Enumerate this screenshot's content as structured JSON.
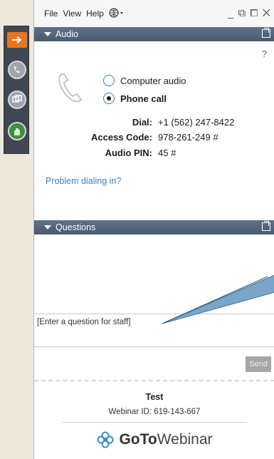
{
  "menubar": {
    "file": "File",
    "view": "View",
    "help": "Help",
    "globe_icon": "globe-icon",
    "window_controls": "_ ⧉ ⧠ ✕"
  },
  "audio": {
    "header": "Audio",
    "help_mark": "?",
    "option_computer": "Computer audio",
    "option_phone": "Phone call",
    "dial_label": "Dial:",
    "dial_value": "+1 (562) 247-8422",
    "access_label": "Access Code:",
    "access_value": "978-261-249 #",
    "pin_label": "Audio PIN:",
    "pin_value": "45 #",
    "problem_link": "Problem dialing in?"
  },
  "questions": {
    "header": "Questions",
    "placeholder": "[Enter a question for staff]",
    "send_label": "Send"
  },
  "footer": {
    "title": "Test",
    "webinar_id": "Webinar ID: 619-143-667",
    "brand_goto": "GoTo",
    "brand_webinar": "Webinar"
  },
  "colors": {
    "header_bg": "#56667d",
    "accent_orange": "#e8761e",
    "link_blue": "#3b7fc7"
  }
}
